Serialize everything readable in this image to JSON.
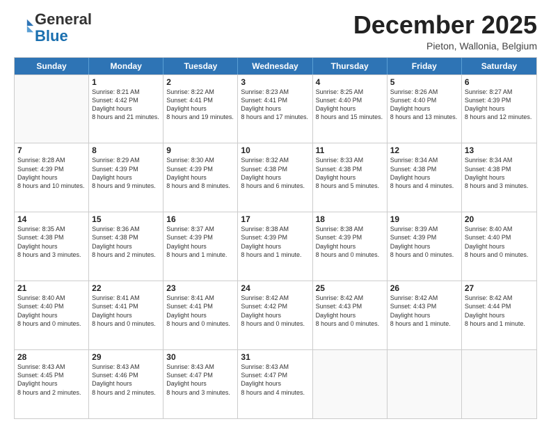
{
  "logo": {
    "general": "General",
    "blue": "Blue"
  },
  "header": {
    "month": "December 2025",
    "location": "Pieton, Wallonia, Belgium"
  },
  "days_of_week": [
    "Sunday",
    "Monday",
    "Tuesday",
    "Wednesday",
    "Thursday",
    "Friday",
    "Saturday"
  ],
  "weeks": [
    [
      {
        "day": "",
        "empty": true
      },
      {
        "day": "1",
        "sunrise": "8:21 AM",
        "sunset": "4:42 PM",
        "daylight": "8 hours and 21 minutes."
      },
      {
        "day": "2",
        "sunrise": "8:22 AM",
        "sunset": "4:41 PM",
        "daylight": "8 hours and 19 minutes."
      },
      {
        "day": "3",
        "sunrise": "8:23 AM",
        "sunset": "4:41 PM",
        "daylight": "8 hours and 17 minutes."
      },
      {
        "day": "4",
        "sunrise": "8:25 AM",
        "sunset": "4:40 PM",
        "daylight": "8 hours and 15 minutes."
      },
      {
        "day": "5",
        "sunrise": "8:26 AM",
        "sunset": "4:40 PM",
        "daylight": "8 hours and 13 minutes."
      },
      {
        "day": "6",
        "sunrise": "8:27 AM",
        "sunset": "4:39 PM",
        "daylight": "8 hours and 12 minutes."
      }
    ],
    [
      {
        "day": "7",
        "sunrise": "8:28 AM",
        "sunset": "4:39 PM",
        "daylight": "8 hours and 10 minutes."
      },
      {
        "day": "8",
        "sunrise": "8:29 AM",
        "sunset": "4:39 PM",
        "daylight": "8 hours and 9 minutes."
      },
      {
        "day": "9",
        "sunrise": "8:30 AM",
        "sunset": "4:39 PM",
        "daylight": "8 hours and 8 minutes."
      },
      {
        "day": "10",
        "sunrise": "8:32 AM",
        "sunset": "4:38 PM",
        "daylight": "8 hours and 6 minutes."
      },
      {
        "day": "11",
        "sunrise": "8:33 AM",
        "sunset": "4:38 PM",
        "daylight": "8 hours and 5 minutes."
      },
      {
        "day": "12",
        "sunrise": "8:34 AM",
        "sunset": "4:38 PM",
        "daylight": "8 hours and 4 minutes."
      },
      {
        "day": "13",
        "sunrise": "8:34 AM",
        "sunset": "4:38 PM",
        "daylight": "8 hours and 3 minutes."
      }
    ],
    [
      {
        "day": "14",
        "sunrise": "8:35 AM",
        "sunset": "4:38 PM",
        "daylight": "8 hours and 3 minutes."
      },
      {
        "day": "15",
        "sunrise": "8:36 AM",
        "sunset": "4:38 PM",
        "daylight": "8 hours and 2 minutes."
      },
      {
        "day": "16",
        "sunrise": "8:37 AM",
        "sunset": "4:39 PM",
        "daylight": "8 hours and 1 minute."
      },
      {
        "day": "17",
        "sunrise": "8:38 AM",
        "sunset": "4:39 PM",
        "daylight": "8 hours and 1 minute."
      },
      {
        "day": "18",
        "sunrise": "8:38 AM",
        "sunset": "4:39 PM",
        "daylight": "8 hours and 0 minutes."
      },
      {
        "day": "19",
        "sunrise": "8:39 AM",
        "sunset": "4:39 PM",
        "daylight": "8 hours and 0 minutes."
      },
      {
        "day": "20",
        "sunrise": "8:40 AM",
        "sunset": "4:40 PM",
        "daylight": "8 hours and 0 minutes."
      }
    ],
    [
      {
        "day": "21",
        "sunrise": "8:40 AM",
        "sunset": "4:40 PM",
        "daylight": "8 hours and 0 minutes."
      },
      {
        "day": "22",
        "sunrise": "8:41 AM",
        "sunset": "4:41 PM",
        "daylight": "8 hours and 0 minutes."
      },
      {
        "day": "23",
        "sunrise": "8:41 AM",
        "sunset": "4:41 PM",
        "daylight": "8 hours and 0 minutes."
      },
      {
        "day": "24",
        "sunrise": "8:42 AM",
        "sunset": "4:42 PM",
        "daylight": "8 hours and 0 minutes."
      },
      {
        "day": "25",
        "sunrise": "8:42 AM",
        "sunset": "4:43 PM",
        "daylight": "8 hours and 0 minutes."
      },
      {
        "day": "26",
        "sunrise": "8:42 AM",
        "sunset": "4:43 PM",
        "daylight": "8 hours and 1 minute."
      },
      {
        "day": "27",
        "sunrise": "8:42 AM",
        "sunset": "4:44 PM",
        "daylight": "8 hours and 1 minute."
      }
    ],
    [
      {
        "day": "28",
        "sunrise": "8:43 AM",
        "sunset": "4:45 PM",
        "daylight": "8 hours and 2 minutes."
      },
      {
        "day": "29",
        "sunrise": "8:43 AM",
        "sunset": "4:46 PM",
        "daylight": "8 hours and 2 minutes."
      },
      {
        "day": "30",
        "sunrise": "8:43 AM",
        "sunset": "4:47 PM",
        "daylight": "8 hours and 3 minutes."
      },
      {
        "day": "31",
        "sunrise": "8:43 AM",
        "sunset": "4:47 PM",
        "daylight": "8 hours and 4 minutes."
      },
      {
        "day": "",
        "empty": true
      },
      {
        "day": "",
        "empty": true
      },
      {
        "day": "",
        "empty": true
      }
    ]
  ]
}
